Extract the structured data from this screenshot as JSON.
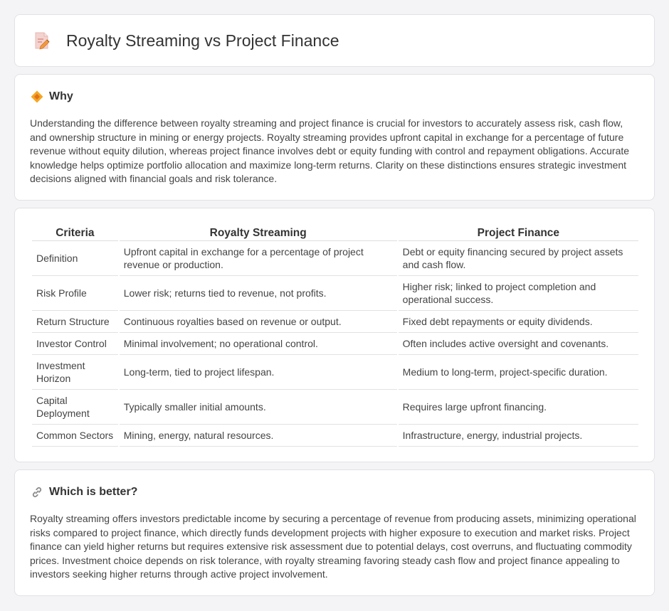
{
  "header": {
    "title": "Royalty Streaming vs Project Finance",
    "icon": "document-edit-icon"
  },
  "why": {
    "title": "Why",
    "icon": "diamond-icon",
    "text": "Understanding the difference between royalty streaming and project finance is crucial for investors to accurately assess risk, cash flow, and ownership structure in mining or energy projects. Royalty streaming provides upfront capital in exchange for a percentage of future revenue without equity dilution, whereas project finance involves debt or equity funding with control and repayment obligations. Accurate knowledge helps optimize portfolio allocation and maximize long-term returns. Clarity on these distinctions ensures strategic investment decisions aligned with financial goals and risk tolerance."
  },
  "table": {
    "headers": [
      "Criteria",
      "Royalty Streaming",
      "Project Finance"
    ],
    "rows": [
      [
        "Definition",
        "Upfront capital in exchange for a percentage of project revenue or production.",
        "Debt or equity financing secured by project assets and cash flow."
      ],
      [
        "Risk Profile",
        "Lower risk; returns tied to revenue, not profits.",
        "Higher risk; linked to project completion and operational success."
      ],
      [
        "Return Structure",
        "Continuous royalties based on revenue or output.",
        "Fixed debt repayments or equity dividends."
      ],
      [
        "Investor Control",
        "Minimal involvement; no operational control.",
        "Often includes active oversight and covenants."
      ],
      [
        "Investment Horizon",
        "Long-term, tied to project lifespan.",
        "Medium to long-term, project-specific duration."
      ],
      [
        "Capital Deployment",
        "Typically smaller initial amounts.",
        "Requires large upfront financing."
      ],
      [
        "Common Sectors",
        "Mining, energy, natural resources.",
        "Infrastructure, energy, industrial projects."
      ]
    ]
  },
  "better": {
    "title": "Which is better?",
    "icon": "link-icon",
    "text": "Royalty streaming offers investors predictable income by securing a percentage of revenue from producing assets, minimizing operational risks compared to project finance, which directly funds development projects with higher exposure to execution and market risks. Project finance can yield higher returns but requires extensive risk assessment due to potential delays, cost overruns, and fluctuating commodity prices. Investment choice depends on risk tolerance, with royalty streaming favoring steady cash flow and project finance appealing to investors seeking higher returns through active project involvement."
  }
}
